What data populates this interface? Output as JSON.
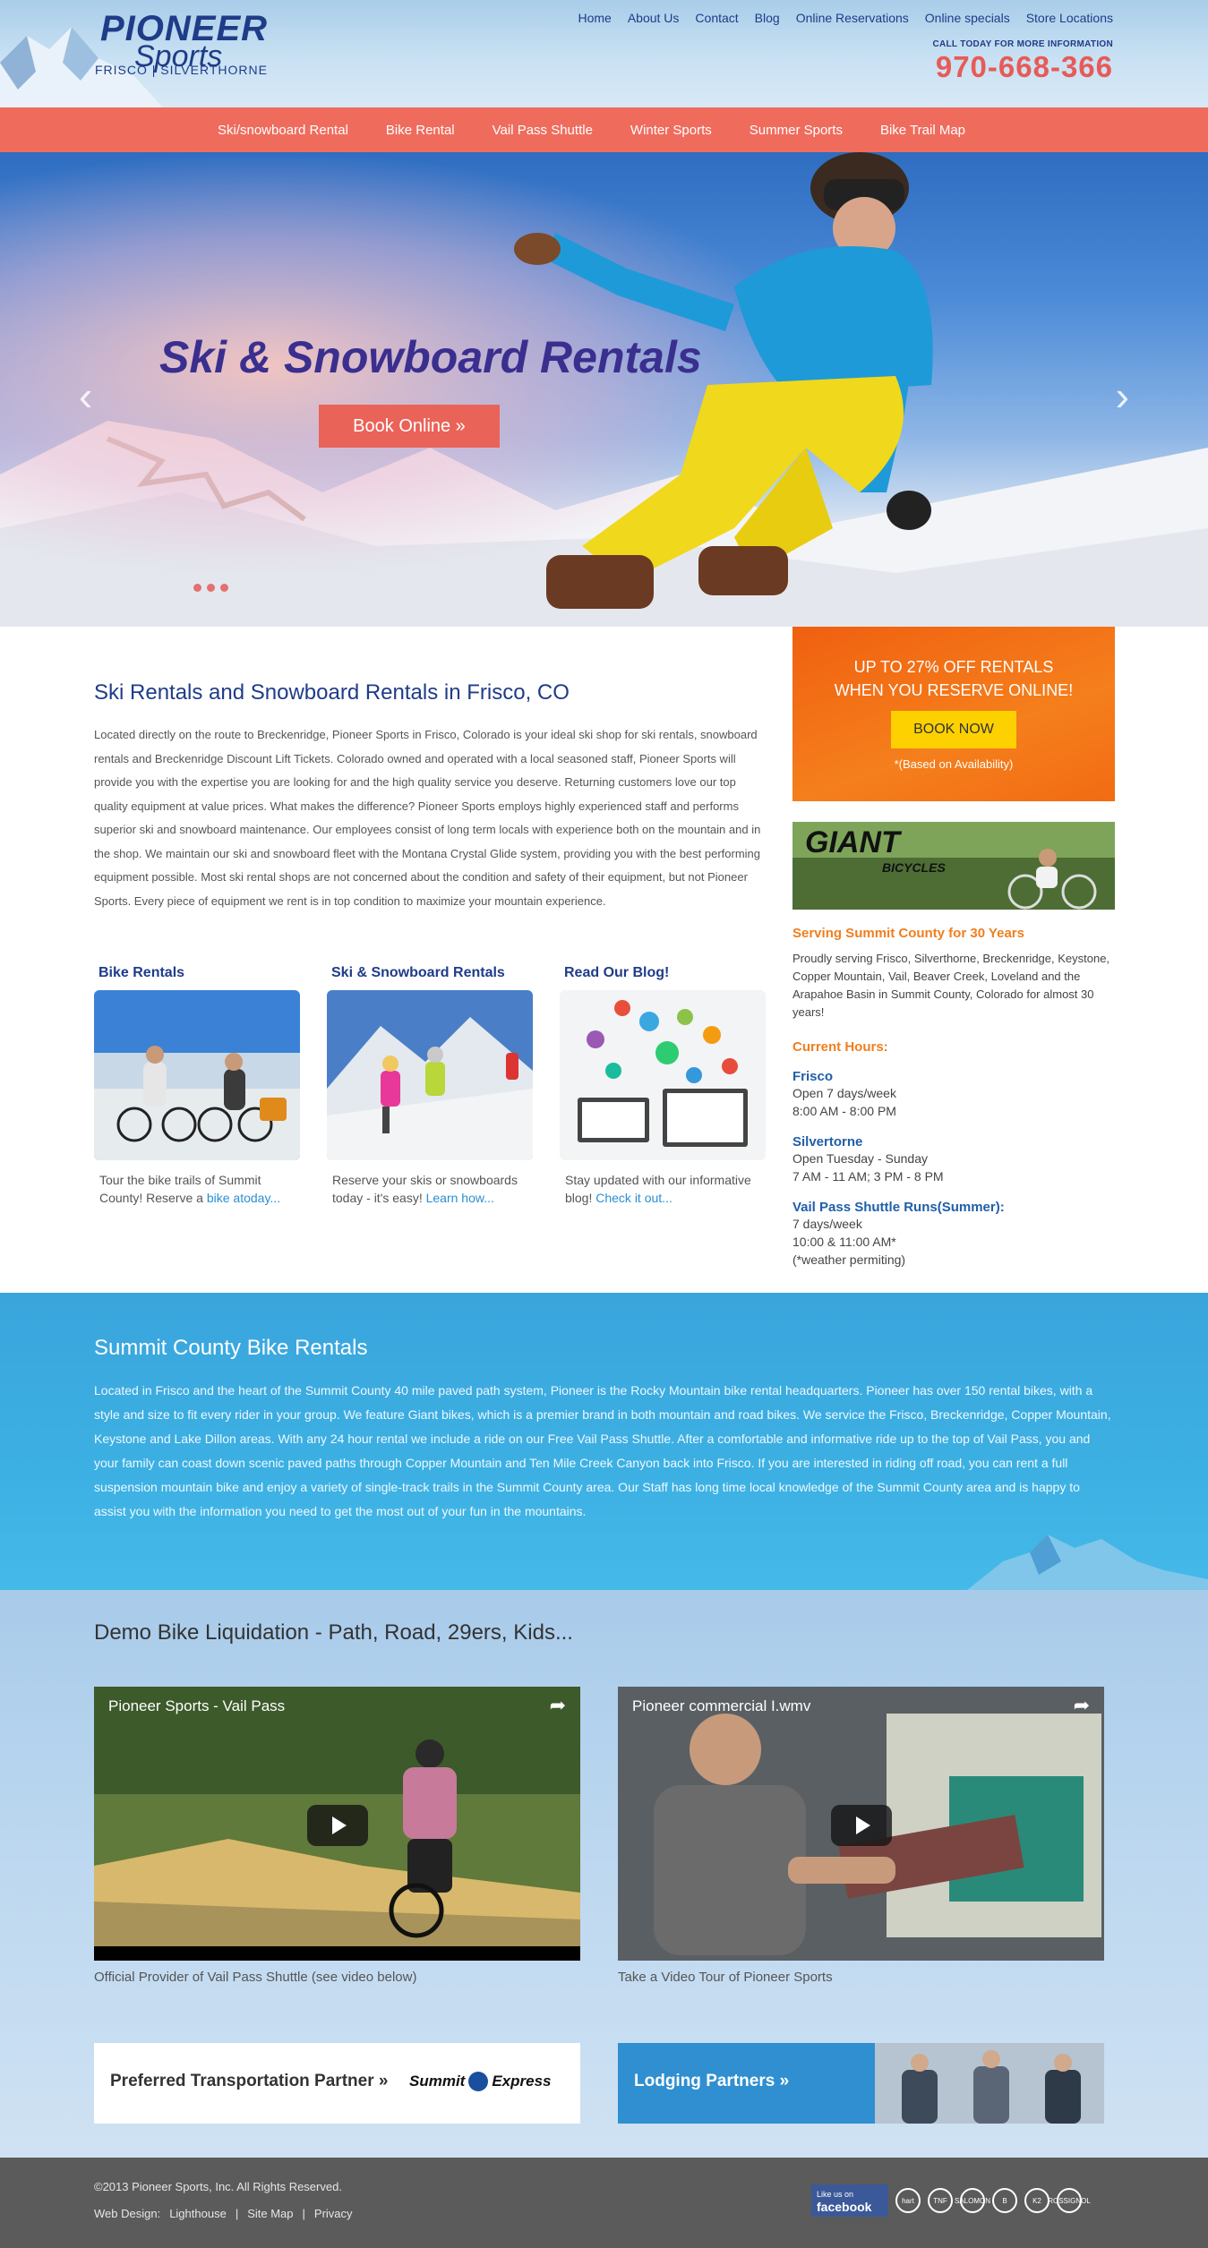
{
  "header": {
    "logo_main": "PIONEER",
    "logo_sub": "Sports",
    "logo_locations": "FRISCO  |  SILVERTHORNE",
    "top_nav": [
      "Home",
      "About Us",
      "Contact",
      "Blog",
      "Online Reservations",
      "Online specials",
      "Store Locations"
    ],
    "call_label": "CALL TODAY FOR MORE INFORMATION",
    "phone": "970-668-366"
  },
  "main_nav": [
    "Ski/snowboard Rental",
    "Bike Rental",
    "Vail Pass Shuttle",
    "Winter Sports",
    "Summer Sports",
    "Bike Trail Map"
  ],
  "hero": {
    "title": "Ski & Snowboard Rentals",
    "button": "Book Online »",
    "prev_icon": "‹",
    "next_icon": "›"
  },
  "intro": {
    "heading": "Ski Rentals and Snowboard Rentals in Frisco, CO",
    "body": "Located directly on the route to Breckenridge, Pioneer Sports in Frisco, Colorado is your ideal ski shop for ski rentals, snowboard rentals and Breckenridge Discount Lift Tickets. Colorado owned and operated with a local seasoned staff, Pioneer Sports will provide you with the expertise you are looking for and the high quality service you deserve. Returning customers love our top quality equipment at value prices. What makes the difference? Pioneer Sports employs highly experienced staff and performs superior ski and snowboard maintenance. Our employees consist of long term locals with experience both on the mountain and in the shop. We maintain our ski and snowboard fleet with the Montana Crystal Glide system, providing you with the best performing equipment possible. Most ski rental shops are not concerned about the condition and safety of their equipment, but not Pioneer Sports. Every piece of equipment we rent is in top condition to maximize your mountain experience."
  },
  "cards": [
    {
      "title": "Bike Rentals",
      "text": "Tour the bike trails of Summit County! Reserve a ",
      "link": "bike atoday..."
    },
    {
      "title": "Ski & Snowboard Rentals",
      "text": "Reserve your skis or snowboards today - it's easy! ",
      "link": "Learn how..."
    },
    {
      "title": "Read Our Blog!",
      "text": "Stay updated with our informative blog! ",
      "link": "Check it out..."
    }
  ],
  "promo": {
    "title": "UP TO 27% OFF RENTALS WHEN YOU RESERVE ONLINE!",
    "button": "BOOK NOW",
    "note": "*(Based on Availability)"
  },
  "giant": {
    "brand": "GIANT",
    "sub": "BICYCLES"
  },
  "serving": {
    "heading": "Serving Summit County for 30 Years",
    "body": "Proudly serving Frisco, Silverthorne, Breckenridge, Keystone, Copper Mountain, Vail, Beaver Creek, Loveland and the Arapahoe Basin in Summit County, Colorado for almost 30 years!",
    "hours_heading": "Current Hours:",
    "locations": [
      {
        "name": "Frisco",
        "lines": [
          "Open 7 days/week",
          "8:00 AM - 8:00 PM"
        ]
      },
      {
        "name": "Silvertorne",
        "lines": [
          "Open Tuesday - Sunday",
          "7 AM - 11 AM; 3 PM - 8 PM"
        ]
      },
      {
        "name": "Vail Pass Shuttle Runs(Summer):",
        "lines": [
          "7 days/week",
          "10:00 & 11:00 AM*",
          "(*weather permiting)"
        ]
      }
    ]
  },
  "bike_band": {
    "heading": "Summit County Bike Rentals",
    "body": "Located in Frisco and the heart of the Summit County 40 mile paved path system, Pioneer is the Rocky Mountain bike rental headquarters. Pioneer has over 150 rental bikes, with a style and size to fit every rider in your group. We feature Giant bikes, which is a premier brand in both mountain and road bikes. We service the Frisco, Breckenridge, Copper Mountain, Keystone and Lake Dillon areas. With any 24 hour rental we include a ride on our Free Vail Pass Shuttle. After a comfortable and informative ride up to the top of Vail Pass, you and your family can coast down scenic paved paths through Copper Mountain and Ten Mile Creek Canyon back into Frisco. If you are interested in riding off road, you can rent a full suspension mountain bike and enjoy a variety of single-track trails in the Summit County area. Our Staff has long time local knowledge of the Summit County area and is happy to assist you with the information you need to get the most out of your fun in the mountains."
  },
  "demo": {
    "heading": "Demo Bike Liquidation - Path, Road, 29ers, Kids...",
    "videos": [
      {
        "title": "Pioneer Sports - Vail Pass",
        "caption": "Official Provider of Vail Pass Shuttle (see video below)"
      },
      {
        "title": "Pioneer commercial I.wmv",
        "caption": "Take a Video Tour of Pioneer Sports"
      }
    ],
    "share_icon": "➦"
  },
  "partners": {
    "transport_label": "Preferred Transportation Partner »",
    "summit_logo_left": "Summit",
    "summit_logo_right": "Express",
    "lodging_label": "Lodging Partners »"
  },
  "footer": {
    "copyright": "©2013 Pioneer Sports, Inc. All Rights Reserved.",
    "web_design_label": "Web Design:",
    "links": [
      "Lighthouse",
      "Site Map",
      "Privacy"
    ],
    "separator": "|",
    "facebook_small": "Like us on",
    "facebook_big": "facebook",
    "brands": [
      "hart",
      "TNF",
      "SALOMON",
      "B",
      "K2",
      "ROSSIGNOL"
    ]
  }
}
